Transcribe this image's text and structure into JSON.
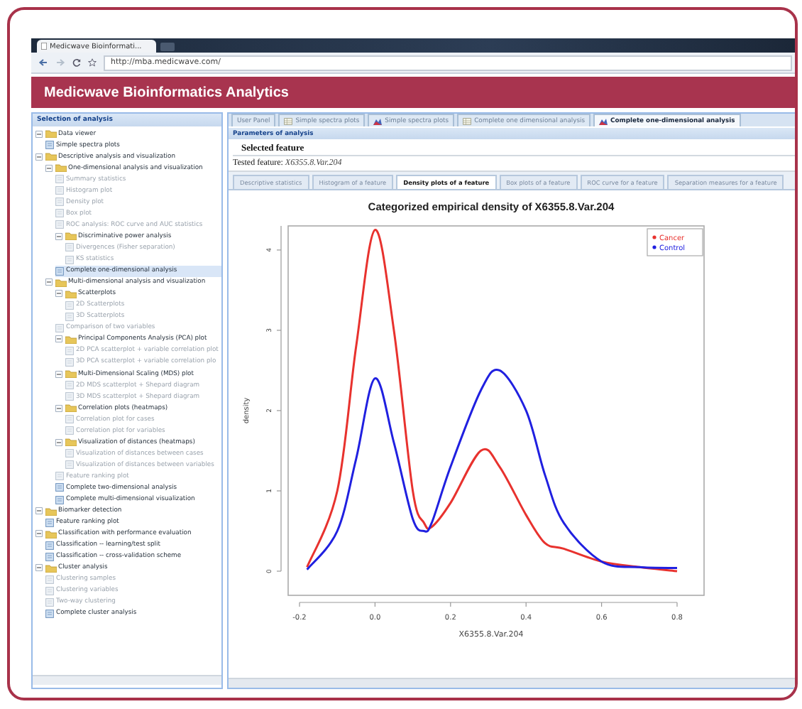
{
  "browser": {
    "tab_title": "Medicwave Bioinformati...",
    "url": "http://mba.medicwave.com/"
  },
  "app_title": "Medicwave Bioinformatics Analytics",
  "sidebar": {
    "title": "Selection of analysis",
    "tree": [
      {
        "label": "Data viewer",
        "kind": "folder",
        "expanded": true,
        "disabled": false,
        "selected": false,
        "children": [
          {
            "label": "Simple spectra plots",
            "kind": "item",
            "disabled": false,
            "selected": false
          }
        ]
      },
      {
        "label": "Descriptive analysis and visualization",
        "kind": "folder",
        "expanded": true,
        "disabled": false,
        "selected": false,
        "children": [
          {
            "label": "One-dimensional analysis and visualization",
            "kind": "folder",
            "expanded": true,
            "disabled": false,
            "selected": false,
            "children": [
              {
                "label": "Summary statistics",
                "kind": "item",
                "disabled": true,
                "selected": false
              },
              {
                "label": "Histogram plot",
                "kind": "item",
                "disabled": true,
                "selected": false
              },
              {
                "label": "Density plot",
                "kind": "item",
                "disabled": true,
                "selected": false
              },
              {
                "label": "Box plot",
                "kind": "item",
                "disabled": true,
                "selected": false
              },
              {
                "label": "ROC analysis: ROC curve and AUC statistics",
                "kind": "item",
                "disabled": true,
                "selected": false
              },
              {
                "label": "Discriminative power analysis",
                "kind": "folder",
                "expanded": true,
                "disabled": false,
                "selected": false,
                "children": [
                  {
                    "label": "Divergences (Fisher separation)",
                    "kind": "item",
                    "disabled": true,
                    "selected": false
                  },
                  {
                    "label": "KS statistics",
                    "kind": "item",
                    "disabled": true,
                    "selected": false
                  }
                ]
              },
              {
                "label": "Complete one-dimensional analysis",
                "kind": "item",
                "disabled": false,
                "selected": true
              }
            ]
          },
          {
            "label": "Multi-dimensional analysis and visualization",
            "kind": "folder",
            "expanded": true,
            "disabled": false,
            "selected": false,
            "children": [
              {
                "label": "Scatterplots",
                "kind": "folder",
                "expanded": true,
                "disabled": false,
                "selected": false,
                "children": [
                  {
                    "label": "2D Scatterplots",
                    "kind": "item",
                    "disabled": true,
                    "selected": false
                  },
                  {
                    "label": "3D Scatterplots",
                    "kind": "item",
                    "disabled": true,
                    "selected": false
                  }
                ]
              },
              {
                "label": "Comparison of two variables",
                "kind": "item",
                "disabled": true,
                "selected": false
              },
              {
                "label": "Principal Components Analysis (PCA) plot",
                "kind": "folder",
                "expanded": true,
                "disabled": false,
                "selected": false,
                "children": [
                  {
                    "label": "2D PCA scatterplot + variable correlation plot",
                    "kind": "item",
                    "disabled": true,
                    "selected": false
                  },
                  {
                    "label": "3D PCA scatterplot + variable correlation plo",
                    "kind": "item",
                    "disabled": true,
                    "selected": false
                  }
                ]
              },
              {
                "label": "Multi-Dimensional Scaling (MDS) plot",
                "kind": "folder",
                "expanded": true,
                "disabled": false,
                "selected": false,
                "children": [
                  {
                    "label": "2D MDS scatterplot + Shepard diagram",
                    "kind": "item",
                    "disabled": true,
                    "selected": false
                  },
                  {
                    "label": "3D MDS scatterplot + Shepard diagram",
                    "kind": "item",
                    "disabled": true,
                    "selected": false
                  }
                ]
              },
              {
                "label": "Correlation plots (heatmaps)",
                "kind": "folder",
                "expanded": true,
                "disabled": false,
                "selected": false,
                "children": [
                  {
                    "label": "Correlation plot for cases",
                    "kind": "item",
                    "disabled": true,
                    "selected": false
                  },
                  {
                    "label": "Correlation plot for variables",
                    "kind": "item",
                    "disabled": true,
                    "selected": false
                  }
                ]
              },
              {
                "label": "Visualization of distances (heatmaps)",
                "kind": "folder",
                "expanded": true,
                "disabled": false,
                "selected": false,
                "children": [
                  {
                    "label": "Visualization of distances between cases",
                    "kind": "item",
                    "disabled": true,
                    "selected": false
                  },
                  {
                    "label": "Visualization of distances between variables",
                    "kind": "item",
                    "disabled": true,
                    "selected": false
                  }
                ]
              },
              {
                "label": "Feature ranking plot",
                "kind": "item",
                "disabled": true,
                "selected": false
              },
              {
                "label": "Complete two-dimensional analysis",
                "kind": "item",
                "disabled": false,
                "selected": false
              },
              {
                "label": "Complete multi-dimensional visualization",
                "kind": "item",
                "disabled": false,
                "selected": false
              }
            ]
          }
        ]
      },
      {
        "label": "Biomarker detection",
        "kind": "folder",
        "expanded": true,
        "disabled": false,
        "selected": false,
        "children": [
          {
            "label": "Feature ranking plot",
            "kind": "item",
            "disabled": false,
            "selected": false
          }
        ]
      },
      {
        "label": "Classification with performance evaluation",
        "kind": "folder",
        "expanded": true,
        "disabled": false,
        "selected": false,
        "children": [
          {
            "label": "Classification -- learning/test split",
            "kind": "item",
            "disabled": false,
            "selected": false
          },
          {
            "label": "Classification -- cross-validation scheme",
            "kind": "item",
            "disabled": false,
            "selected": false
          }
        ]
      },
      {
        "label": "Cluster analysis",
        "kind": "folder",
        "expanded": true,
        "disabled": false,
        "selected": false,
        "children": [
          {
            "label": "Clustering samples",
            "kind": "item",
            "disabled": true,
            "selected": false
          },
          {
            "label": "Clustering variables",
            "kind": "item",
            "disabled": true,
            "selected": false
          },
          {
            "label": "Two-way clustering",
            "kind": "item",
            "disabled": true,
            "selected": false
          },
          {
            "label": "Complete cluster analysis",
            "kind": "item",
            "disabled": false,
            "selected": false
          }
        ]
      }
    ]
  },
  "tabs": [
    {
      "label": "User Panel",
      "kind": "plain",
      "selected": false
    },
    {
      "label": "Simple spectra plots",
      "kind": "table",
      "selected": false
    },
    {
      "label": "Simple spectra plots",
      "kind": "chart",
      "selected": false
    },
    {
      "label": "Complete one dimensional analysis",
      "kind": "table",
      "selected": false
    },
    {
      "label": "Complete one-dimensional analysis",
      "kind": "chart",
      "selected": true
    }
  ],
  "parameters_title": "Parameters of analysis",
  "feature": {
    "heading": "Selected feature",
    "label": "Tested feature:",
    "value": "X6355.8.Var.204"
  },
  "subtabs": [
    {
      "label": "Descriptive statistics",
      "selected": false
    },
    {
      "label": "Histogram of a feature",
      "selected": false
    },
    {
      "label": "Density plots of a feature",
      "selected": true
    },
    {
      "label": "Box plots of a feature",
      "selected": false
    },
    {
      "label": "ROC curve for a feature",
      "selected": false
    },
    {
      "label": "Separation measures for a feature",
      "selected": false
    }
  ],
  "chart_data": {
    "type": "line",
    "title": "Categorized empirical density of  X6355.8.Var.204",
    "xlabel": "X6355.8.Var.204",
    "ylabel": "density",
    "x": [
      -0.18,
      -0.1,
      -0.05,
      0,
      0.05,
      0.1,
      0.13,
      0.15,
      0.2,
      0.28,
      0.33,
      0.4,
      0.45,
      0.5,
      0.6,
      0.7,
      0.8
    ],
    "series": [
      {
        "name": "Cancer",
        "color": "#e8322e",
        "values": [
          0.05,
          1.0,
          2.8,
          4.25,
          3.0,
          1.0,
          0.6,
          0.55,
          0.85,
          1.5,
          1.3,
          0.7,
          0.35,
          0.28,
          0.12,
          0.05,
          0.0
        ]
      },
      {
        "name": "Control",
        "color": "#2020e0",
        "values": [
          0.02,
          0.5,
          1.4,
          2.4,
          1.6,
          0.65,
          0.5,
          0.6,
          1.3,
          2.25,
          2.5,
          2.0,
          1.2,
          0.6,
          0.12,
          0.05,
          0.04
        ]
      }
    ],
    "xlim": [
      -0.2,
      0.8
    ],
    "ylim": [
      0,
      4.3
    ],
    "xticks": [
      -0.2,
      {
        "value": 0,
        "label": "0.0"
      },
      0.2,
      0.4,
      0.6,
      0.8
    ],
    "yticks": [
      0,
      1,
      2,
      3,
      4
    ]
  }
}
